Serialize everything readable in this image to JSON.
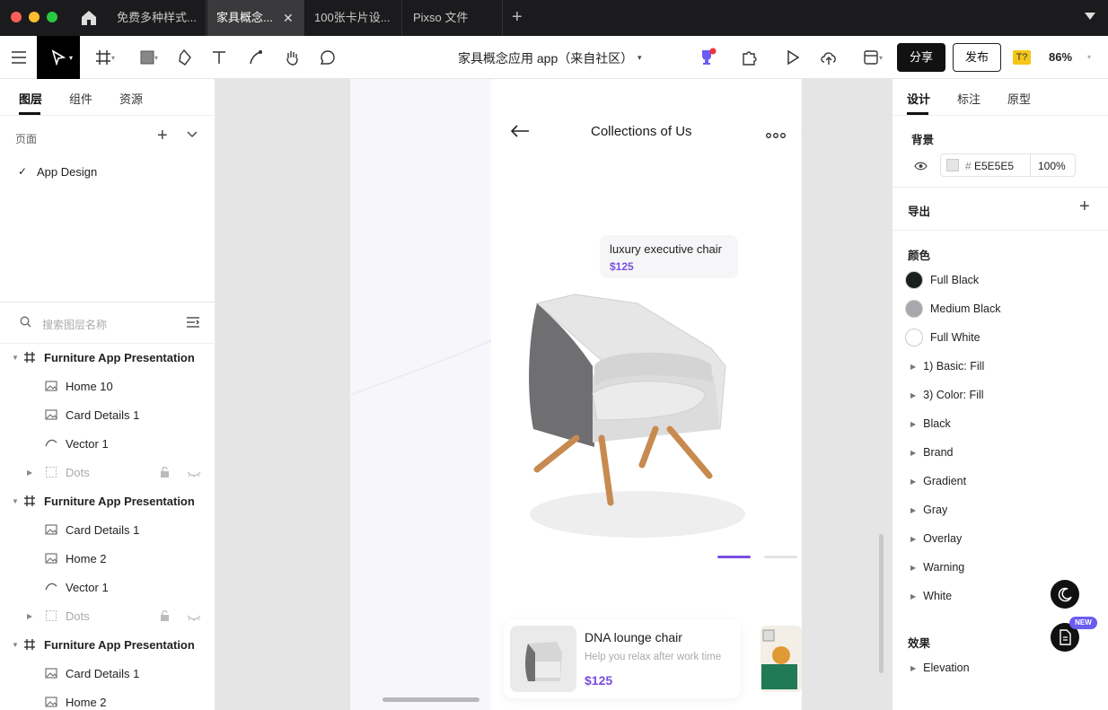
{
  "tabbar": {
    "tabs": [
      {
        "label": "免费多种样式..."
      },
      {
        "label": "家具概念..."
      },
      {
        "label": "100张卡片设..."
      },
      {
        "label": "Pixso 文件"
      }
    ]
  },
  "toolbar": {
    "file_title": "家具概念应用 app（来自社区）",
    "share_label": "分享",
    "publish_label": "发布",
    "font_badge": "T?",
    "zoom": "86%"
  },
  "left_panel": {
    "tabs": [
      "图层",
      "组件",
      "资源"
    ],
    "pages_label": "页面",
    "page_item": "App Design",
    "search_placeholder": "搜索图层名称",
    "layers": [
      {
        "label": "Furniture App Presentation",
        "type": "frame"
      },
      {
        "label": "Home 10",
        "type": "image"
      },
      {
        "label": "Card Details 1",
        "type": "image"
      },
      {
        "label": "Vector 1",
        "type": "vector"
      },
      {
        "label": "Dots",
        "type": "group"
      },
      {
        "label": "Furniture App Presentation",
        "type": "frame"
      },
      {
        "label": "Card Details 1",
        "type": "image"
      },
      {
        "label": "Home 2",
        "type": "image"
      },
      {
        "label": "Vector 1",
        "type": "vector"
      },
      {
        "label": "Dots",
        "type": "group"
      },
      {
        "label": "Furniture App Presentation",
        "type": "frame"
      },
      {
        "label": "Card Details 1",
        "type": "image"
      },
      {
        "label": "Home 2",
        "type": "image"
      }
    ]
  },
  "canvas": {
    "screen_title": "Collections of Us",
    "tooltip_name": "luxury executive chair",
    "tooltip_price": "$125",
    "card_title": "DNA lounge chair",
    "card_desc": "Help you relax after work time",
    "card_price": "$125"
  },
  "right_panel": {
    "tabs": [
      "设计",
      "标注",
      "原型"
    ],
    "background_label": "背景",
    "bg_hash": "#",
    "bg_hex": "E5E5E5",
    "bg_opacity": "100%",
    "export_label": "导出",
    "colors_label": "颜色",
    "color_styles": [
      {
        "label": "Full Black",
        "color": "#1a1f1f"
      },
      {
        "label": "Medium Black",
        "color": "#a8a8ac"
      },
      {
        "label": "Full White",
        "color": "#ffffff"
      }
    ],
    "color_groups": [
      "1) Basic: Fill",
      "3) Color: Fill",
      "Black",
      "Brand",
      "Gradient",
      "Gray",
      "Overlay",
      "Warning",
      "White"
    ],
    "effects_label": "效果",
    "effects": [
      "Elevation"
    ],
    "new_badge": "NEW"
  },
  "colors": {
    "accent": "#7a4fe0",
    "tab_active": "#3a3a3c"
  }
}
